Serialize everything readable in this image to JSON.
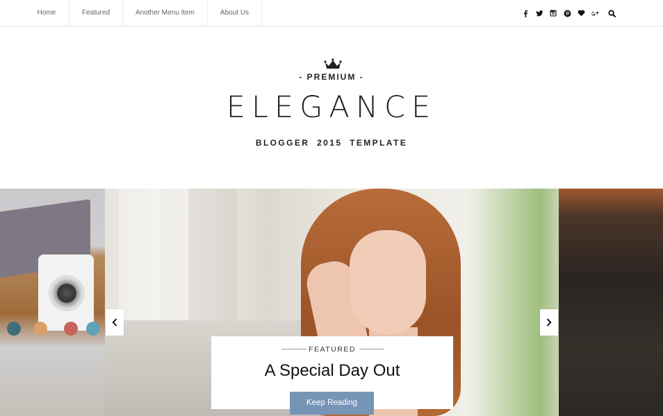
{
  "nav": {
    "items": [
      {
        "label": "Home"
      },
      {
        "label": "Featured"
      },
      {
        "label": "Another Menu Item"
      },
      {
        "label": "About Us"
      }
    ],
    "social_icons": [
      "facebook-icon",
      "twitter-icon",
      "instagram-icon",
      "pinterest-icon",
      "heart-icon",
      "google-plus-icon"
    ],
    "search_icon": "search-icon"
  },
  "logo": {
    "premium": "- PREMIUM -",
    "brand": "ELEGANCE",
    "tagline": "BLOGGER 2015 TEMPLATE"
  },
  "slider": {
    "caption": {
      "label": "FEATURED",
      "title": "A Special Day Out",
      "button": "Keep Reading"
    },
    "accent_color": "#7694b6"
  }
}
